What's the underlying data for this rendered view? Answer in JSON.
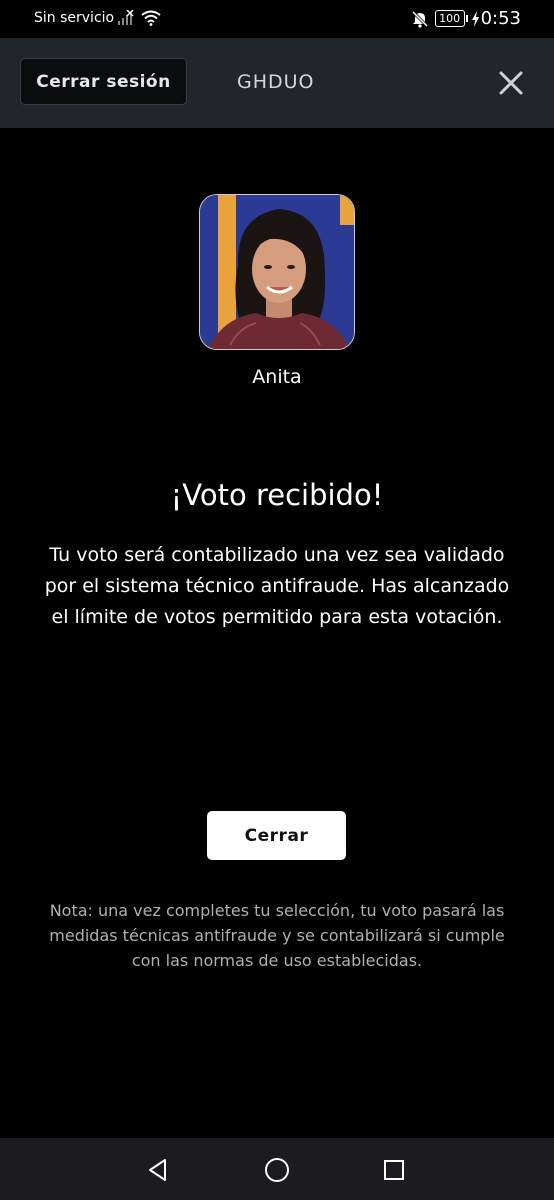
{
  "status_bar": {
    "carrier": "Sin servicio",
    "battery": "100",
    "time": "0:53",
    "icons": [
      "signal-off-icon",
      "wifi-icon",
      "mute-icon",
      "battery-icon",
      "charging-icon"
    ]
  },
  "header": {
    "logout_label": "Cerrar sesión",
    "title": "GHDUO",
    "close_icon": "close-icon"
  },
  "candidate": {
    "name": "Anita"
  },
  "confirmation": {
    "title": "¡Voto recibido!",
    "message": "Tu voto será contabilizado una vez sea validado por el sistema técnico antifraude. Has alcanzado el límite de votos permitido para esta votación."
  },
  "actions": {
    "close_label": "Cerrar"
  },
  "note": "Nota: una vez completes tu selección, tu voto pasará las medidas técnicas antifraude y se contabilizará si cumple con las normas de uso establecidas.",
  "nav_bar": {
    "icons": [
      "back-icon",
      "home-icon",
      "recents-icon"
    ]
  },
  "colors": {
    "background": "#000000",
    "header_bg": "#22262b",
    "button_bg": "#ffffff",
    "note_text": "#b0b0b0"
  }
}
